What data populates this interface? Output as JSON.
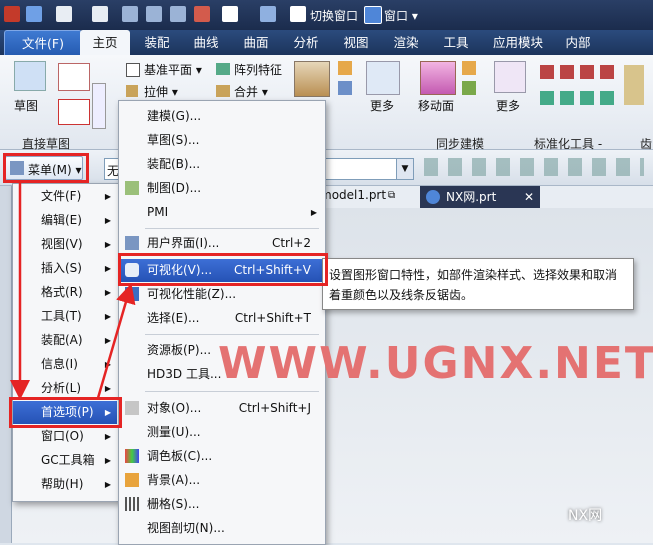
{
  "titlebar": {
    "switch_window": "切换窗口",
    "window_menu": "窗口 ▾"
  },
  "tabs": [
    "文件(F)",
    "主页",
    "装配",
    "曲线",
    "曲面",
    "分析",
    "视图",
    "渲染",
    "工具",
    "应用模块",
    "内部"
  ],
  "ribbon": {
    "sketch": "草图",
    "datum_plane": "基准平面 ▾",
    "array_feature": "阵列特征",
    "extrude": "拉伸 ▾",
    "unite": "合并 ▾",
    "more1": "更多",
    "move_face": "移动面",
    "more2": "更多",
    "group_direct_sketch": "直接草图",
    "group_sync": "同步建模",
    "group_std": "标准化工具 -",
    "group_gear": "齿"
  },
  "toolbar2": {
    "menu_label": "菜单(M) ▾",
    "filter_value": "无"
  },
  "parts": {
    "tab1": "model1.prt",
    "tab2": "NX网.prt"
  },
  "main_menu": [
    {
      "label": "文件(F)",
      "arrow": "▶"
    },
    {
      "label": "编辑(E)",
      "arrow": "▶"
    },
    {
      "label": "视图(V)",
      "arrow": "▶"
    },
    {
      "label": "插入(S)",
      "arrow": "▶"
    },
    {
      "label": "格式(R)",
      "arrow": "▶"
    },
    {
      "label": "工具(T)",
      "arrow": "▶"
    },
    {
      "label": "装配(A)",
      "arrow": "▶"
    },
    {
      "label": "信息(I)",
      "arrow": "▶"
    },
    {
      "label": "分析(L)",
      "arrow": "▶"
    },
    {
      "label": "首选项(P)",
      "arrow": "▶"
    },
    {
      "label": "窗口(O)",
      "arrow": "▶"
    },
    {
      "label": "GC工具箱",
      "arrow": "▶"
    },
    {
      "label": "帮助(H)",
      "arrow": "▶"
    }
  ],
  "sub_menu": [
    {
      "label": "建模(G)...",
      "shortcut": ""
    },
    {
      "label": "草图(S)...",
      "shortcut": ""
    },
    {
      "label": "装配(B)...",
      "shortcut": ""
    },
    {
      "label": "制图(D)...",
      "shortcut": ""
    },
    {
      "label": "PMI",
      "shortcut": "▶"
    },
    {
      "label": "用户界面(I)...",
      "shortcut": "Ctrl+2"
    },
    {
      "label": "可视化(V)...",
      "shortcut": "Ctrl+Shift+V"
    },
    {
      "label": "可视化性能(Z)...",
      "shortcut": ""
    },
    {
      "label": "选择(E)...",
      "shortcut": "Ctrl+Shift+T"
    },
    {
      "label": "资源板(P)...",
      "shortcut": ""
    },
    {
      "label": "HD3D 工具...",
      "shortcut": ""
    },
    {
      "label": "对象(O)...",
      "shortcut": "Ctrl+Shift+J"
    },
    {
      "label": "测量(U)...",
      "shortcut": ""
    },
    {
      "label": "调色板(C)...",
      "shortcut": ""
    },
    {
      "label": "背景(A)...",
      "shortcut": ""
    },
    {
      "label": "栅格(S)...",
      "shortcut": ""
    },
    {
      "label": "视图剖切(N)...",
      "shortcut": ""
    }
  ],
  "tooltip": "设置图形窗口特性，如部件渲染样式、选择效果和取消着重颜色以及线条反锯齿。",
  "watermark": "WWW.UGNX.NET",
  "brand": "NX网",
  "colors": {
    "highlight": "#2f5fc6",
    "annotation_red": "#e52424",
    "title_bg": "#1f3256"
  }
}
